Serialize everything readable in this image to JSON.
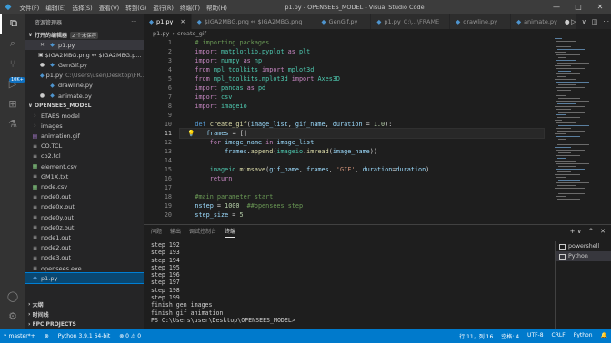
{
  "window": {
    "title": "p1.py - OPENSEES_MODEL - Visual Studio Code",
    "menu": [
      "文件(F)",
      "编辑(E)",
      "选择(S)",
      "查看(V)",
      "转到(G)",
      "运行(R)",
      "终端(T)",
      "帮助(H)"
    ],
    "controls": [
      "—",
      "□",
      "✕"
    ]
  },
  "activity": {
    "badge": "10K+"
  },
  "sidebar": {
    "header": "资源管理器",
    "more": "···",
    "open_editors_label": "打开的编辑器",
    "open_editors_tag": "2 个未保存",
    "open_editors": [
      {
        "label": "p1.py",
        "dim": "",
        "icon": "✕"
      },
      {
        "label": "$IGA2MBG.png ↔ $IGA2MBG.p...",
        "dim": "",
        "icon": "▣"
      },
      {
        "label": "GenGif.py",
        "dim": "",
        "icon": "●"
      },
      {
        "label": "p1.py",
        "dim": "C:\\Users\\user\\Desktop\\FR...",
        "icon": ""
      },
      {
        "label": "drawline.py",
        "dim": "",
        "icon": ""
      },
      {
        "label": "animate.py",
        "dim": "",
        "icon": "●"
      }
    ],
    "project_label": "OPENSEES_MODEL",
    "files": [
      {
        "label": "ETABS model",
        "icon": "›"
      },
      {
        "label": "images",
        "icon": "›"
      },
      {
        "label": "animation.gif",
        "icon": "▤"
      },
      {
        "label": "CO.TCL",
        "icon": "≡"
      },
      {
        "label": "co2.tcl",
        "icon": "≡"
      },
      {
        "label": "element.csv",
        "icon": "▦"
      },
      {
        "label": "GM1X.txt",
        "icon": "≡"
      },
      {
        "label": "node.csv",
        "icon": "▦"
      },
      {
        "label": "node0.out",
        "icon": "≡"
      },
      {
        "label": "node0x.out",
        "icon": "≡"
      },
      {
        "label": "node0y.out",
        "icon": "≡"
      },
      {
        "label": "node0z.out",
        "icon": "≡"
      },
      {
        "label": "node1.out",
        "icon": "≡"
      },
      {
        "label": "node2.out",
        "icon": "≡"
      },
      {
        "label": "node3.out",
        "icon": "≡"
      },
      {
        "label": "opensees.exe",
        "icon": "≡"
      },
      {
        "label": "p1.py",
        "icon": "◆"
      }
    ],
    "outline_label": "大纲",
    "timeline_label": "时间线",
    "fpc_label": "FPC PROJECTS"
  },
  "tabs": [
    {
      "label": "p1.py",
      "dim": "",
      "close": "✕",
      "active": true
    },
    {
      "label": "$IGA2MBG.png ↔ $IGA2MBG.png",
      "dim": "",
      "close": "",
      "active": false
    },
    {
      "label": "GenGif.py",
      "dim": "",
      "close": "",
      "active": false
    },
    {
      "label": "p1.py",
      "dim": "C:\\...\\FRAME",
      "close": "",
      "active": false
    },
    {
      "label": "drawline.py",
      "dim": "",
      "close": "",
      "active": false
    },
    {
      "label": "animate.py",
      "dim": "",
      "close": "●",
      "active": false
    }
  ],
  "tab_controls": [
    "▷",
    "∨",
    "◫",
    "···"
  ],
  "breadcrumb": [
    "p1.py",
    "›",
    "create_gif"
  ],
  "code": [
    {
      "n": "1",
      "t": [
        [
          "c-com",
          "    # importing packages"
        ]
      ]
    },
    {
      "n": "2",
      "t": [
        [
          "c-kw",
          "    import "
        ],
        [
          "c-ty",
          "matplotlib.pyplot"
        ],
        [
          "c-kw",
          " as "
        ],
        [
          "c-ty",
          "plt"
        ]
      ]
    },
    {
      "n": "3",
      "t": [
        [
          "c-kw",
          "    import "
        ],
        [
          "c-ty",
          "numpy"
        ],
        [
          "c-kw",
          " as "
        ],
        [
          "c-ty",
          "np"
        ]
      ]
    },
    {
      "n": "4",
      "t": [
        [
          "c-kw",
          "    from "
        ],
        [
          "c-ty",
          "mpl_toolkits"
        ],
        [
          "c-kw",
          " import "
        ],
        [
          "c-ty",
          "mplot3d"
        ]
      ]
    },
    {
      "n": "5",
      "t": [
        [
          "c-kw",
          "    from "
        ],
        [
          "c-ty",
          "mpl_toolkits.mplot3d"
        ],
        [
          "c-kw",
          " import "
        ],
        [
          "c-ty",
          "Axes3D"
        ]
      ]
    },
    {
      "n": "6",
      "t": [
        [
          "c-kw",
          "    import "
        ],
        [
          "c-ty",
          "pandas"
        ],
        [
          "c-kw",
          " as "
        ],
        [
          "c-ty",
          "pd"
        ]
      ]
    },
    {
      "n": "7",
      "t": [
        [
          "c-kw",
          "    import "
        ],
        [
          "c-ty",
          "csv"
        ]
      ]
    },
    {
      "n": "8",
      "t": [
        [
          "c-kw",
          "    import "
        ],
        [
          "c-ty",
          "imageio"
        ]
      ]
    },
    {
      "n": "9",
      "t": [
        [
          "",
          "    "
        ]
      ]
    },
    {
      "n": "10",
      "t": [
        [
          "c-kb",
          "    def "
        ],
        [
          "c-fn",
          "create_gif"
        ],
        [
          "",
          "("
        ],
        [
          "c-var",
          "image_list"
        ],
        [
          "",
          ", "
        ],
        [
          "c-var",
          "gif_name"
        ],
        [
          "",
          ", "
        ],
        [
          "c-var",
          "duration"
        ],
        [
          "",
          " = "
        ],
        [
          "c-num",
          "1.0"
        ],
        [
          "",
          "):"
        ]
      ]
    },
    {
      "n": "11",
      "t": [
        [
          "",
          "  💡   "
        ],
        [
          "c-var",
          "frames"
        ],
        [
          "",
          " = []"
        ]
      ],
      "cur": true
    },
    {
      "n": "12",
      "t": [
        [
          "c-kw",
          "        for "
        ],
        [
          "c-var",
          "image_name"
        ],
        [
          "c-kw",
          " in "
        ],
        [
          "c-var",
          "image_list"
        ],
        [
          "",
          ":"
        ]
      ]
    },
    {
      "n": "13",
      "t": [
        [
          "c-var",
          "            frames"
        ],
        [
          "",
          "."
        ],
        [
          "c-fn",
          "append"
        ],
        [
          "",
          "("
        ],
        [
          "c-ty",
          "imageio"
        ],
        [
          "",
          "."
        ],
        [
          "c-fn",
          "imread"
        ],
        [
          "",
          "("
        ],
        [
          "c-var",
          "image_name"
        ],
        [
          "",
          "))"
        ]
      ]
    },
    {
      "n": "14",
      "t": [
        [
          "",
          "    "
        ]
      ]
    },
    {
      "n": "15",
      "t": [
        [
          "c-ty",
          "        imageio"
        ],
        [
          "",
          "."
        ],
        [
          "c-fn",
          "mimsave"
        ],
        [
          "",
          "("
        ],
        [
          "c-var",
          "gif_name"
        ],
        [
          "",
          ", "
        ],
        [
          "c-var",
          "frames"
        ],
        [
          "",
          ", "
        ],
        [
          "c-str",
          "'GIF'"
        ],
        [
          "",
          ", "
        ],
        [
          "c-var",
          "duration"
        ],
        [
          "",
          "="
        ],
        [
          "c-var",
          "duration"
        ],
        [
          "",
          ")"
        ]
      ]
    },
    {
      "n": "16",
      "t": [
        [
          "c-kw",
          "        return"
        ]
      ]
    },
    {
      "n": "17",
      "t": [
        [
          "",
          "    "
        ]
      ]
    },
    {
      "n": "18",
      "t": [
        [
          "c-com",
          "    #main parameter start"
        ]
      ]
    },
    {
      "n": "19",
      "t": [
        [
          "c-var",
          "    nstep"
        ],
        [
          "",
          " = "
        ],
        [
          "c-num",
          "1000"
        ],
        [
          "c-com",
          "  ##opensees step"
        ]
      ]
    },
    {
      "n": "20",
      "t": [
        [
          "c-var",
          "    step_size"
        ],
        [
          "",
          " = "
        ],
        [
          "c-num",
          "5"
        ]
      ]
    }
  ],
  "panel": {
    "tabs": [
      "问题",
      "输出",
      "调试控制台",
      "终端"
    ],
    "controls": [
      "+ ∨",
      "^",
      "✕"
    ],
    "lines": [
      "step 192",
      "step 193",
      "step 194",
      "step 195",
      "step 196",
      "step 197",
      "step 198",
      "step 199",
      "finish gen images",
      "finish gif animation",
      "PS C:\\Users\\user\\Desktop\\OPENSEES_MODEL> "
    ],
    "terminals": [
      "powershell",
      "Python"
    ]
  },
  "status": {
    "left": [
      "⑂ master*+",
      "⊗",
      "Python 3.9.1 64-bit",
      "⊗ 0 ⚠ 0"
    ],
    "right": [
      "行 11，列 16",
      "空格: 4",
      "UTF-8",
      "CRLF",
      "Python",
      "🔔"
    ]
  }
}
